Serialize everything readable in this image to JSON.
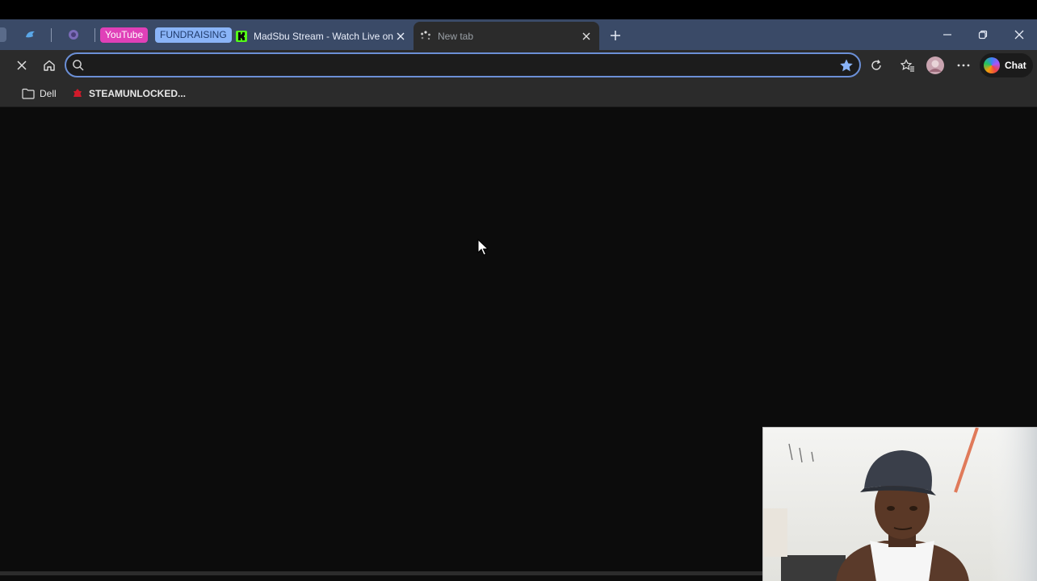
{
  "tabs": {
    "groups": [
      {
        "label": "YouTube",
        "bg": "#e040b8",
        "fg": "#ffffff"
      },
      {
        "label": "FUNDRAISING",
        "bg": "#8ab4f8",
        "fg": "#1f3a6b"
      }
    ],
    "items": [
      {
        "title": "MadSbu Stream - Watch Live on K",
        "favicon": "kick-icon",
        "active": false
      },
      {
        "title": "New tab",
        "favicon": "loading-spinner-icon",
        "active": true
      }
    ]
  },
  "toolbar": {
    "address_value": "",
    "address_placeholder": "",
    "chat_label": "Chat"
  },
  "bookmarks": [
    {
      "label": "Dell",
      "icon": "folder-icon"
    },
    {
      "label": "STEAMUNLOCKED...",
      "icon": "red-favicon-icon"
    }
  ],
  "colors": {
    "tabbar": "#3a4a67",
    "toolbar": "#2b2b2b",
    "page": "#0c0c0c",
    "omnibox_border": "#6b8fd6",
    "star": "#8ab4f8"
  }
}
